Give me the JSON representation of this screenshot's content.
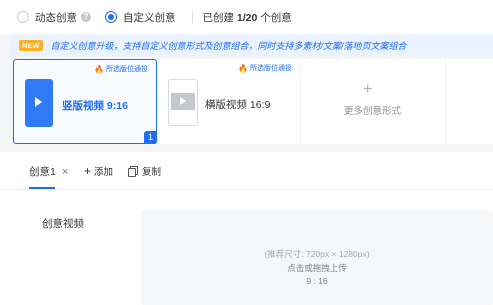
{
  "mode": {
    "dynamic_label": "动态创意",
    "custom_label": "自定义创意",
    "created_text_prefix": "已创建 ",
    "created_count": "1/20",
    "created_text_suffix": " 个创意",
    "selected": "custom"
  },
  "notice": {
    "badge": "NEW",
    "text": "自定义创意升级，支持自定义创意形式及创意组合，同时支持多素材/文案/落地页文案组合"
  },
  "formats": {
    "tag_text": "所选版位通投",
    "vertical_label": "竖版视频 9:16",
    "vertical_count": "1",
    "horizontal_label": "横版视频 16:9",
    "more_label": "更多创意形式",
    "plus": "+"
  },
  "editor": {
    "tab_label": "创意1",
    "close": "×",
    "add_label": "添加",
    "copy_label": "复制",
    "field_label": "创意视频",
    "upload_hint": "(推荐尺寸: 720px × 1280px)",
    "upload_action": "点击或拖拽上传",
    "upload_ratio": "9 : 16"
  },
  "colors": {
    "accent": "#1d6cf5",
    "badge_orange": "#ffb020",
    "fire": "#ff6a1a"
  }
}
